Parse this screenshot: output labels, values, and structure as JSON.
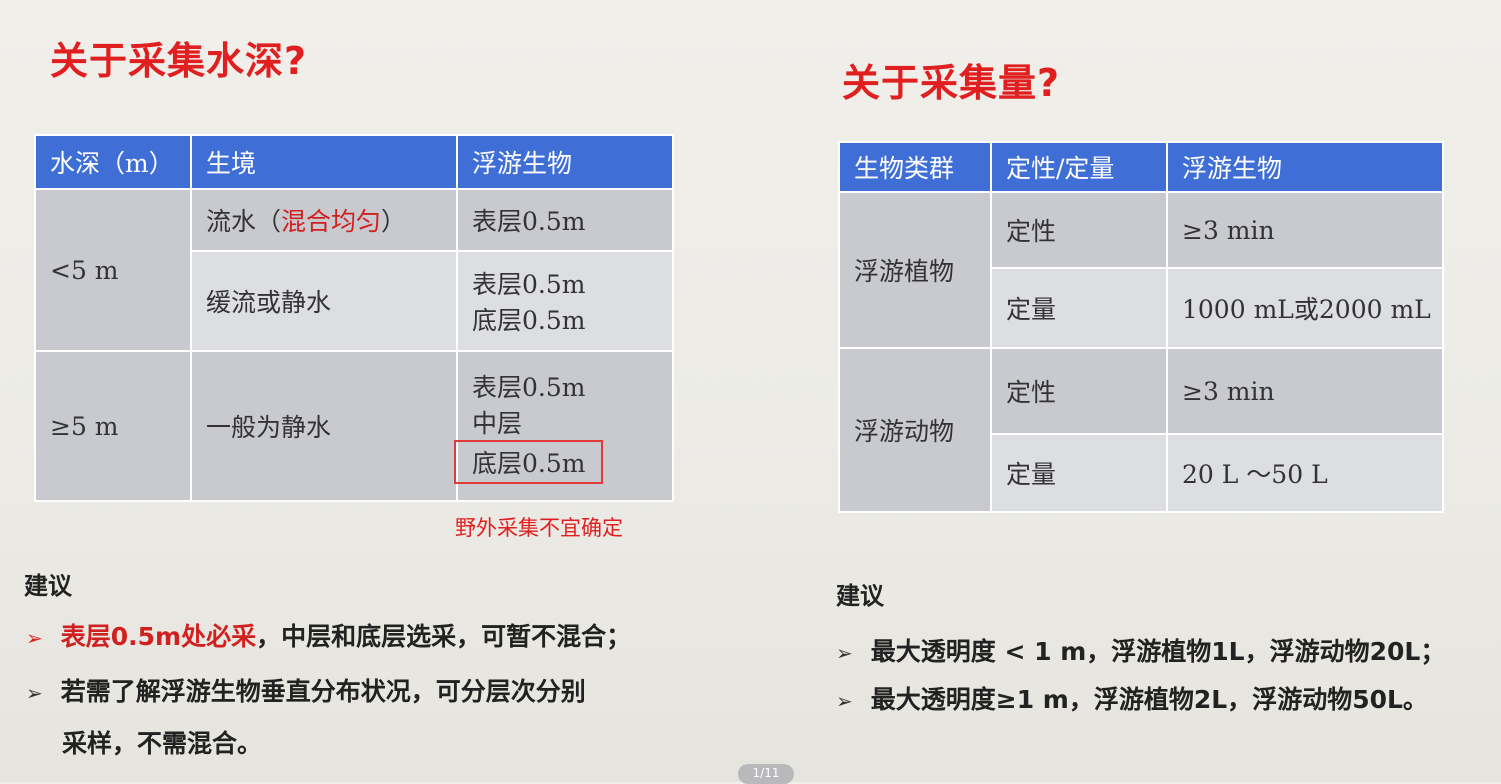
{
  "left": {
    "title": "关于采集水深?",
    "headers": [
      "水深（m）",
      "生境",
      "浮游生物"
    ],
    "rows": {
      "lt5": {
        "depth": "<5 m",
        "habitat1_a": "流水（",
        "habitat1_b": "混合均匀",
        "habitat1_c": "）",
        "sample1": "表层0.5m",
        "habitat2": "缓流或静水",
        "sample2_line1": "表层0.5m",
        "sample2_line2": "底层0.5m"
      },
      "ge5": {
        "depth": "≥5 m",
        "habitat": "一般为静水",
        "sample_line1": "表层0.5m",
        "sample_line2": "中层",
        "sample_line3": "底层0.5m"
      }
    },
    "note": "野外采集不宜确定",
    "suggestion_title": "建议",
    "bullet1_red": "表层0.5m处必采",
    "bullet1_rest": "，中层和底层选采，可暂不混合；",
    "bullet2_line1": "若需了解浮游生物垂直分布状况，可分层次分别",
    "bullet2_line2": "采样，不需混合。"
  },
  "right": {
    "title": "关于采集量?",
    "headers": [
      "生物类群",
      "定性/定量",
      "浮游生物"
    ],
    "phyto": {
      "group": "浮游植物",
      "qual_label": "定性",
      "qual_value": "≥3 min",
      "quant_label": "定量",
      "quant_value": "1000 mL或2000 mL"
    },
    "zoo": {
      "group": "浮游动物",
      "qual_label": "定性",
      "qual_value": "≥3 min",
      "quant_label": "定量",
      "quant_value": "20 L ～50 L"
    },
    "suggestion_title": "建议",
    "bullet1": "最大透明度 < 1 m，浮游植物1L，浮游动物20L；",
    "bullet2": "最大透明度≥1 m，浮游植物2L，浮游动物50L。"
  },
  "bullet_icon": "arrow-bullet-icon",
  "page_indicator": "1/11",
  "colors": {
    "title": "#e02020",
    "header": "#3f6fd6",
    "cell_dark": "#c9cad0",
    "cell_light": "#dddee2"
  }
}
